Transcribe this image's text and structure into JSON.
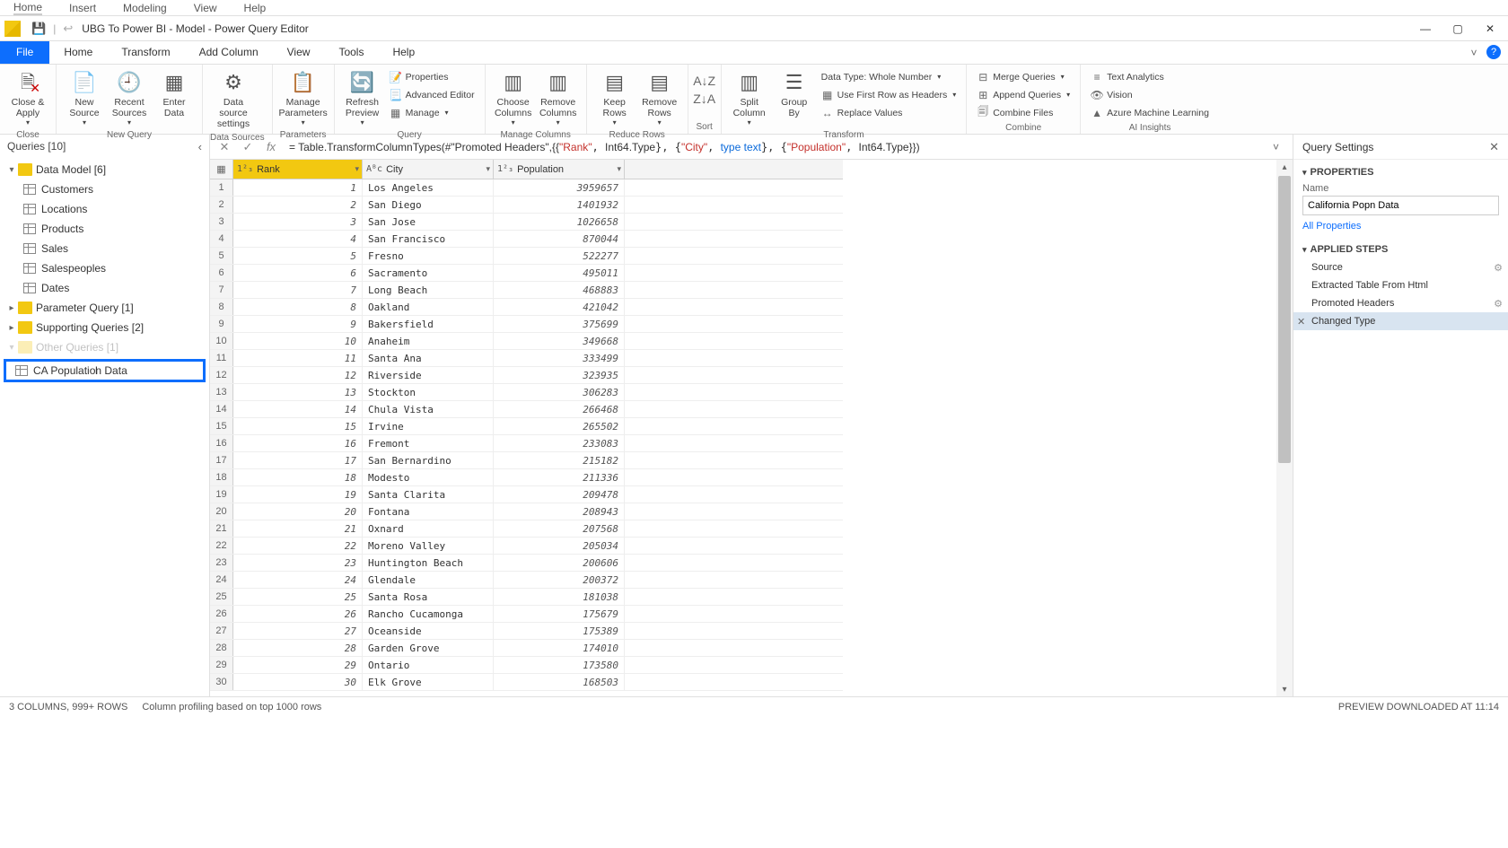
{
  "app_menu": {
    "home": "Home",
    "insert": "Insert",
    "modeling": "Modeling",
    "view": "View",
    "help": "Help"
  },
  "titlebar": {
    "title": "UBG To Power BI - Model - Power Query Editor"
  },
  "menubar": {
    "file": "File",
    "home": "Home",
    "transform": "Transform",
    "add_column": "Add Column",
    "view": "View",
    "tools": "Tools",
    "help": "Help"
  },
  "ribbon": {
    "close": {
      "label": "Close &\nApply",
      "group": "Close"
    },
    "new_source": "New\nSource",
    "recent": "Recent\nSources",
    "enter": "Enter\nData",
    "new_query_group": "New Query",
    "data_source": "Data source\nsettings",
    "data_sources_group": "Data Sources",
    "manage_params": "Manage\nParameters",
    "params_group": "Parameters",
    "refresh": "Refresh\nPreview",
    "properties": "Properties",
    "adv_editor": "Advanced Editor",
    "manage": "Manage",
    "query_group": "Query",
    "choose_cols": "Choose\nColumns",
    "remove_cols": "Remove\nColumns",
    "manage_cols_group": "Manage Columns",
    "keep_rows": "Keep\nRows",
    "remove_rows": "Remove\nRows",
    "reduce_rows_group": "Reduce Rows",
    "sort_group": "Sort",
    "split": "Split\nColumn",
    "group_by": "Group\nBy",
    "data_type": "Data Type: Whole Number",
    "first_row": "Use First Row as Headers",
    "replace": "Replace Values",
    "transform_group": "Transform",
    "merge": "Merge Queries",
    "append": "Append Queries",
    "combine_files": "Combine Files",
    "combine_group": "Combine",
    "text_analytics": "Text Analytics",
    "vision": "Vision",
    "azure_ml": "Azure Machine Learning",
    "ai_group": "AI Insights"
  },
  "queries": {
    "header": "Queries [10]",
    "data_model": "Data Model [6]",
    "customers": "Customers",
    "locations": "Locations",
    "products": "Products",
    "sales": "Sales",
    "salespeoples": "Salespeoples",
    "dates": "Dates",
    "param_query": "Parameter Query [1]",
    "supporting": "Supporting Queries [2]",
    "other": "Other Queries [1]",
    "rename_value": "CA Population Data"
  },
  "formula": {
    "prefix": "= Table.TransformColumnTypes(#\"Promoted Headers\",{{",
    "rank": "\"Rank\"",
    "int_type": "Int64.Type",
    "city": "\"City\"",
    "type_text": "type text",
    "population": "\"Population\"",
    "suffix": "}})"
  },
  "grid": {
    "col_rank": "Rank",
    "col_city": "City",
    "col_pop": "Population",
    "rows": [
      {
        "n": 1,
        "rank": 1,
        "city": "Los Angeles",
        "pop": 3959657
      },
      {
        "n": 2,
        "rank": 2,
        "city": "San Diego",
        "pop": 1401932
      },
      {
        "n": 3,
        "rank": 3,
        "city": "San Jose",
        "pop": 1026658
      },
      {
        "n": 4,
        "rank": 4,
        "city": "San Francisco",
        "pop": 870044
      },
      {
        "n": 5,
        "rank": 5,
        "city": "Fresno",
        "pop": 522277
      },
      {
        "n": 6,
        "rank": 6,
        "city": "Sacramento",
        "pop": 495011
      },
      {
        "n": 7,
        "rank": 7,
        "city": "Long Beach",
        "pop": 468883
      },
      {
        "n": 8,
        "rank": 8,
        "city": "Oakland",
        "pop": 421042
      },
      {
        "n": 9,
        "rank": 9,
        "city": "Bakersfield",
        "pop": 375699
      },
      {
        "n": 10,
        "rank": 10,
        "city": "Anaheim",
        "pop": 349668
      },
      {
        "n": 11,
        "rank": 11,
        "city": "Santa Ana",
        "pop": 333499
      },
      {
        "n": 12,
        "rank": 12,
        "city": "Riverside",
        "pop": 323935
      },
      {
        "n": 13,
        "rank": 13,
        "city": "Stockton",
        "pop": 306283
      },
      {
        "n": 14,
        "rank": 14,
        "city": "Chula Vista",
        "pop": 266468
      },
      {
        "n": 15,
        "rank": 15,
        "city": "Irvine",
        "pop": 265502
      },
      {
        "n": 16,
        "rank": 16,
        "city": "Fremont",
        "pop": 233083
      },
      {
        "n": 17,
        "rank": 17,
        "city": "San Bernardino",
        "pop": 215182
      },
      {
        "n": 18,
        "rank": 18,
        "city": "Modesto",
        "pop": 211336
      },
      {
        "n": 19,
        "rank": 19,
        "city": "Santa Clarita",
        "pop": 209478
      },
      {
        "n": 20,
        "rank": 20,
        "city": "Fontana",
        "pop": 208943
      },
      {
        "n": 21,
        "rank": 21,
        "city": "Oxnard",
        "pop": 207568
      },
      {
        "n": 22,
        "rank": 22,
        "city": "Moreno Valley",
        "pop": 205034
      },
      {
        "n": 23,
        "rank": 23,
        "city": "Huntington Beach",
        "pop": 200606
      },
      {
        "n": 24,
        "rank": 24,
        "city": "Glendale",
        "pop": 200372
      },
      {
        "n": 25,
        "rank": 25,
        "city": "Santa Rosa",
        "pop": 181038
      },
      {
        "n": 26,
        "rank": 26,
        "city": "Rancho Cucamonga",
        "pop": 175679
      },
      {
        "n": 27,
        "rank": 27,
        "city": "Oceanside",
        "pop": 175389
      },
      {
        "n": 28,
        "rank": 28,
        "city": "Garden Grove",
        "pop": 174010
      },
      {
        "n": 29,
        "rank": 29,
        "city": "Ontario",
        "pop": 173580
      },
      {
        "n": 30,
        "rank": 30,
        "city": "Elk Grove",
        "pop": 168503
      }
    ]
  },
  "right": {
    "title": "Query Settings",
    "properties": "PROPERTIES",
    "name_label": "Name",
    "name_value": "California Popn Data",
    "all_props": "All Properties",
    "applied": "APPLIED STEPS",
    "s1": "Source",
    "s2": "Extracted Table From Html",
    "s3": "Promoted Headers",
    "s4": "Changed Type"
  },
  "status": {
    "left": "3 COLUMNS, 999+ ROWS",
    "mid": "Column profiling based on top 1000 rows",
    "right": "PREVIEW DOWNLOADED AT 11:14"
  }
}
